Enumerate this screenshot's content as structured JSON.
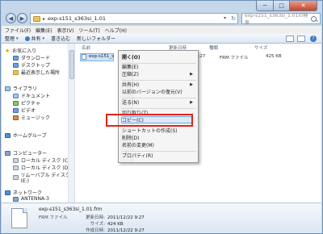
{
  "titlebar": {
    "buttons": [
      "─",
      "□",
      "✕"
    ]
  },
  "address": {
    "folder_name": "exp-s151_s363si_1.01",
    "search_placeholder": "exp-s151_s363si_1.01の検索"
  },
  "menubar": {
    "items": [
      "ファイル(F)",
      "編集(E)",
      "表示(V)",
      "ツール(T)",
      "ヘルプ(H)"
    ]
  },
  "cmdbar": {
    "organize": "整理",
    "share": "共有",
    "burn": "書き込む",
    "new_folder": "新しいフォルダー"
  },
  "nav": {
    "favorites": {
      "label": "お気に入り",
      "items": [
        "ダウンロード",
        "デスクトップ",
        "最近表示した場所"
      ]
    },
    "libraries": {
      "label": "ライブラリ",
      "items": [
        "ドキュメント",
        "ピクチャ",
        "ビデオ",
        "ミュージック"
      ]
    },
    "homegroup": {
      "label": "ホームグループ"
    },
    "computer": {
      "label": "コンピューター",
      "items": [
        "ローカル ディスク (C:)",
        "ローカル ディスク (D:)",
        "リムーバブル ディスク (E:)"
      ]
    },
    "network": {
      "label": "ネットワーク",
      "items": [
        "ANTENNA-3"
      ]
    }
  },
  "columns": {
    "name": "名前",
    "date": "更新日時",
    "type": "種類",
    "size": "サイズ"
  },
  "file": {
    "name": "exp-s151_s",
    "date_partial": "9:27",
    "type": "FRM ファイル",
    "size": "425 KB"
  },
  "context_menu": {
    "items": [
      {
        "label": "開く(O)",
        "bold": true
      },
      {
        "label": "編集(E)"
      },
      {
        "label": "圧縮(Z)",
        "arrow": true
      },
      {
        "label": "共有(H)",
        "arrow": true
      },
      {
        "label": "以前のバージョンの復元(V)"
      },
      {
        "label": "送る(N)",
        "arrow": true
      },
      {
        "label": "切り取り(T)"
      },
      {
        "label": "コピー(C)"
      },
      {
        "label": "ショートカットの作成(S)"
      },
      {
        "label": "削除(D)"
      },
      {
        "label": "名前の変更(M)"
      },
      {
        "label": "プロパティ(R)"
      }
    ]
  },
  "details": {
    "name": "exp-s151_s363si_1.01.frm",
    "type": "FRM ファイル",
    "modified_label": "更新日時:",
    "modified_value": "2011/12/22 9:27",
    "size_label": "サイズ:",
    "size_value": "424 KB",
    "created_label": "作成日時:",
    "created_value": "2011/12/22 9:27"
  },
  "colors": {
    "highlight": "#e2231a",
    "selection": "#cce3fb",
    "chrome": "#c5d7ea"
  }
}
